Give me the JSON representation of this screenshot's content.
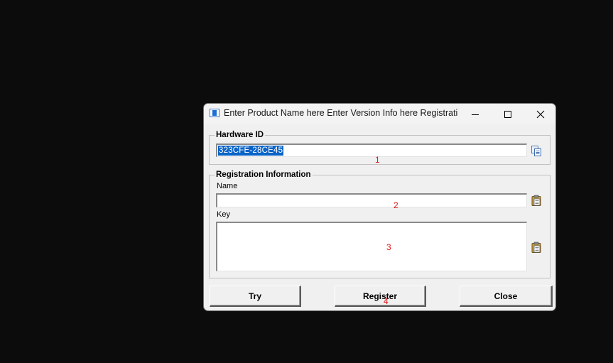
{
  "window": {
    "title": "Enter Product Name here Enter Version Info here Registratio...",
    "controls": {
      "minimize": "minimize-icon",
      "maximize": "maximize-icon",
      "close": "close-icon"
    }
  },
  "hardware": {
    "group_label": "Hardware ID",
    "value": "323CFE-28CE45",
    "copy_icon": "copy-icon"
  },
  "registration": {
    "group_label": "Registration Information",
    "name_label": "Name",
    "name_value": "",
    "key_label": "Key",
    "key_value": "",
    "paste_icon": "paste-icon"
  },
  "buttons": {
    "try": "Try",
    "register": "Register",
    "close": "Close"
  },
  "annotations": [
    "1",
    "2",
    "3",
    "4"
  ],
  "colors": {
    "background": "#0c0c0c",
    "dialog": "#f0f0f0",
    "selection": "#0a64c8",
    "annotation": "#e0191e"
  }
}
